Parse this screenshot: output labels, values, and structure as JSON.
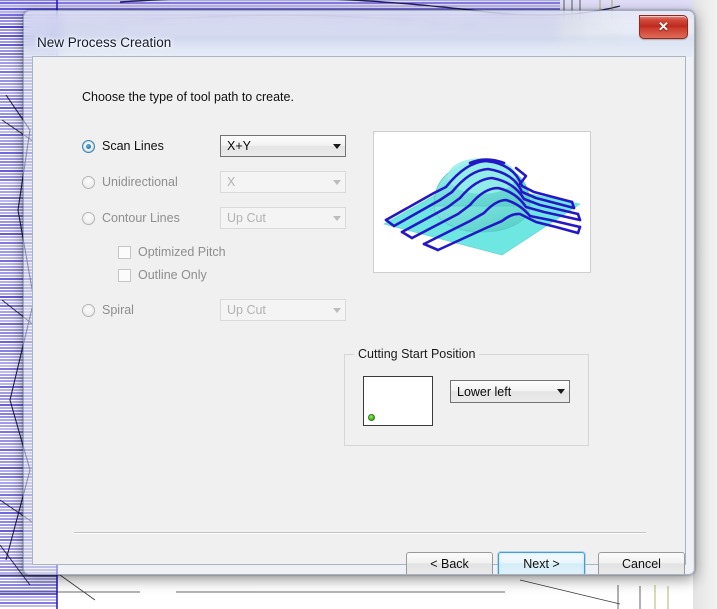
{
  "window": {
    "title": "New Process Creation",
    "close_label": "✕"
  },
  "content": {
    "prompt": "Choose the type of tool path to create.",
    "options": [
      {
        "id": "scan-lines",
        "label": "Scan Lines",
        "selected": true,
        "enabled": true,
        "combo_value": "X+Y",
        "combo_enabled": true
      },
      {
        "id": "unidirectional",
        "label": "Unidirectional",
        "selected": false,
        "enabled": false,
        "combo_value": "X",
        "combo_enabled": false
      },
      {
        "id": "contour-lines",
        "label": "Contour Lines",
        "selected": false,
        "enabled": false,
        "combo_value": "Up Cut",
        "combo_enabled": false
      },
      {
        "id": "spiral",
        "label": "Spiral",
        "selected": false,
        "enabled": false,
        "combo_value": "Up Cut",
        "combo_enabled": false
      }
    ],
    "checkboxes": [
      {
        "id": "optimized-pitch",
        "label": "Optimized Pitch",
        "checked": false,
        "enabled": false
      },
      {
        "id": "outline-only",
        "label": "Outline Only",
        "checked": false,
        "enabled": false
      }
    ],
    "preview_image_alt": "toolpath-3d-preview"
  },
  "cutting_start_position": {
    "group_title": "Cutting Start Position",
    "selected": "Lower left",
    "dot_position": "lower-left",
    "dot_color": "#4fc024"
  },
  "footer": {
    "back_label": "< Back",
    "next_label": "Next >",
    "cancel_label": "Cancel"
  },
  "theme": {
    "accent": "#3c7fb1",
    "close_button": "#bb2a1c",
    "dialog_bg": "#f0f0f0",
    "toolpath_blue": "#2417c8",
    "model_cyan": "#6ce3dd"
  }
}
